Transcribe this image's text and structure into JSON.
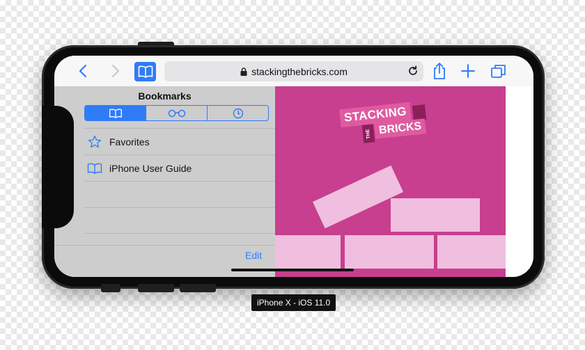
{
  "browser": {
    "url": "stackingthebricks.com"
  },
  "bookmarks_panel": {
    "title": "Bookmarks",
    "tabs": [
      {
        "icon": "book-icon",
        "active": true
      },
      {
        "icon": "reading-list-icon",
        "active": false
      },
      {
        "icon": "history-clock-icon",
        "active": false
      }
    ],
    "items": [
      {
        "label": "Favorites",
        "icon": "star-icon"
      },
      {
        "label": "iPhone User Guide",
        "icon": "book-icon"
      }
    ],
    "edit_label": "Edit"
  },
  "web_content": {
    "logo_line1": "STACKING",
    "logo_the": "THE",
    "logo_line2": "BRICKS",
    "background_color": "#c73f8e",
    "brick_color": "#f0bedf"
  },
  "device_caption": "iPhone X - iOS 11.0",
  "colors": {
    "accent": "#2f7cf6",
    "panel_bg": "#cdcdcd"
  }
}
